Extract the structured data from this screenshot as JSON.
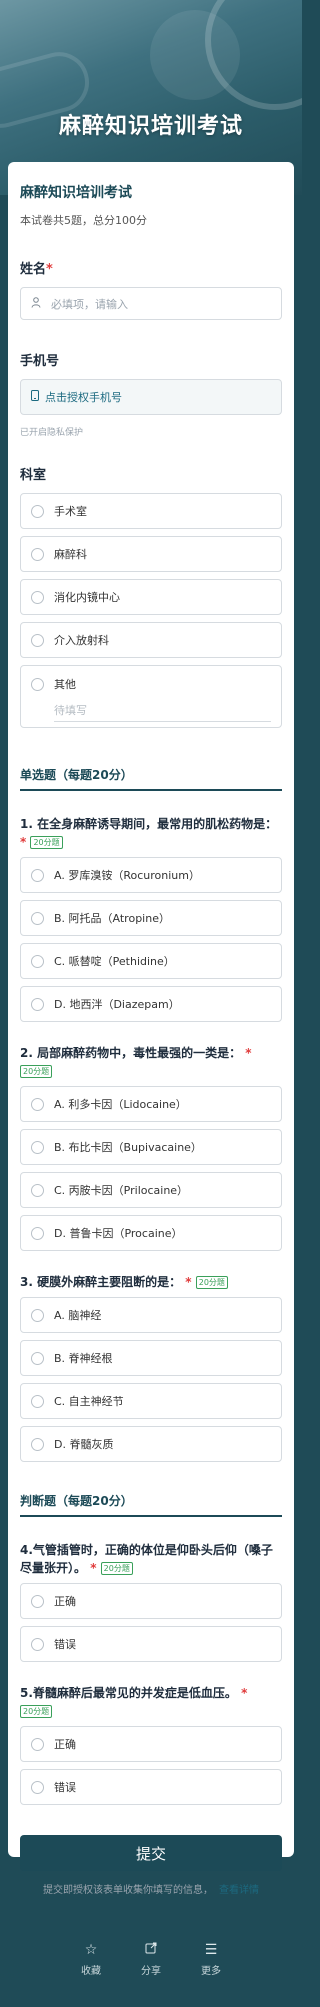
{
  "hero": {
    "title": "麻醉知识培训考试"
  },
  "form": {
    "title": "麻醉知识培训考试",
    "description": "本试卷共5题，总分100分"
  },
  "name_field": {
    "label": "姓名",
    "required_mark": "*",
    "placeholder": "必填项，请输入",
    "icon": "person-icon"
  },
  "phone_field": {
    "label": "手机号",
    "button": "点击授权手机号",
    "hint": "已开启隐私保护",
    "icon": "phone-icon"
  },
  "dept_field": {
    "label": "科室",
    "options": [
      "手术室",
      "麻醉科",
      "消化内镜中心",
      "介入放射科"
    ],
    "other_label": "其他",
    "other_placeholder": "待填写"
  },
  "section_single": {
    "title": "单选题（每题20分）"
  },
  "q1": {
    "title": "1. 在全身麻醉诱导期间，最常用的肌松药物是：",
    "required_mark": "*",
    "score": "20分题",
    "options": [
      "A. 罗库溴铵（Rocuronium）",
      "B. 阿托品（Atropine）",
      "C. 哌替啶（Pethidine）",
      "D. 地西泮（Diazepam）"
    ]
  },
  "q2": {
    "title": "2. 局部麻醉药物中，毒性最强的一类是：",
    "required_mark": "*",
    "score": "20分题",
    "options": [
      "A. 利多卡因（Lidocaine）",
      "B. 布比卡因（Bupivacaine）",
      "C. 丙胺卡因（Prilocaine）",
      "D. 普鲁卡因（Procaine）"
    ]
  },
  "q3": {
    "title": "3. 硬膜外麻醉主要阻断的是：",
    "required_mark": "*",
    "score": "20分题",
    "options": [
      "A. 脑神经",
      "B. 脊神经根",
      "C. 自主神经节",
      "D. 脊髓灰质"
    ]
  },
  "section_tf": {
    "title": "判断题（每题20分）"
  },
  "q4": {
    "title": "4.气管插管时，正确的体位是仰卧头后仰（嗓子尽量张开）。",
    "required_mark": "*",
    "score": "20分题",
    "options": [
      "正确",
      "错误"
    ]
  },
  "q5": {
    "title": "5.脊髓麻醉后最常见的并发症是低血压。",
    "required_mark": "*",
    "score": "20分题",
    "options": [
      "正确",
      "错误"
    ]
  },
  "submit": {
    "label": "提交"
  },
  "notice": {
    "text": "提交即授权该表单收集你填写的信息，",
    "link": "查看详情"
  },
  "bottom_bar": {
    "items": [
      {
        "label": "收藏",
        "icon": "star-icon"
      },
      {
        "label": "分享",
        "icon": "share-icon"
      },
      {
        "label": "更多",
        "icon": "menu-icon"
      }
    ]
  },
  "colors": {
    "primary": "#1c4a57",
    "required": "#e03b3b",
    "score_badge": "#3aa05a"
  }
}
